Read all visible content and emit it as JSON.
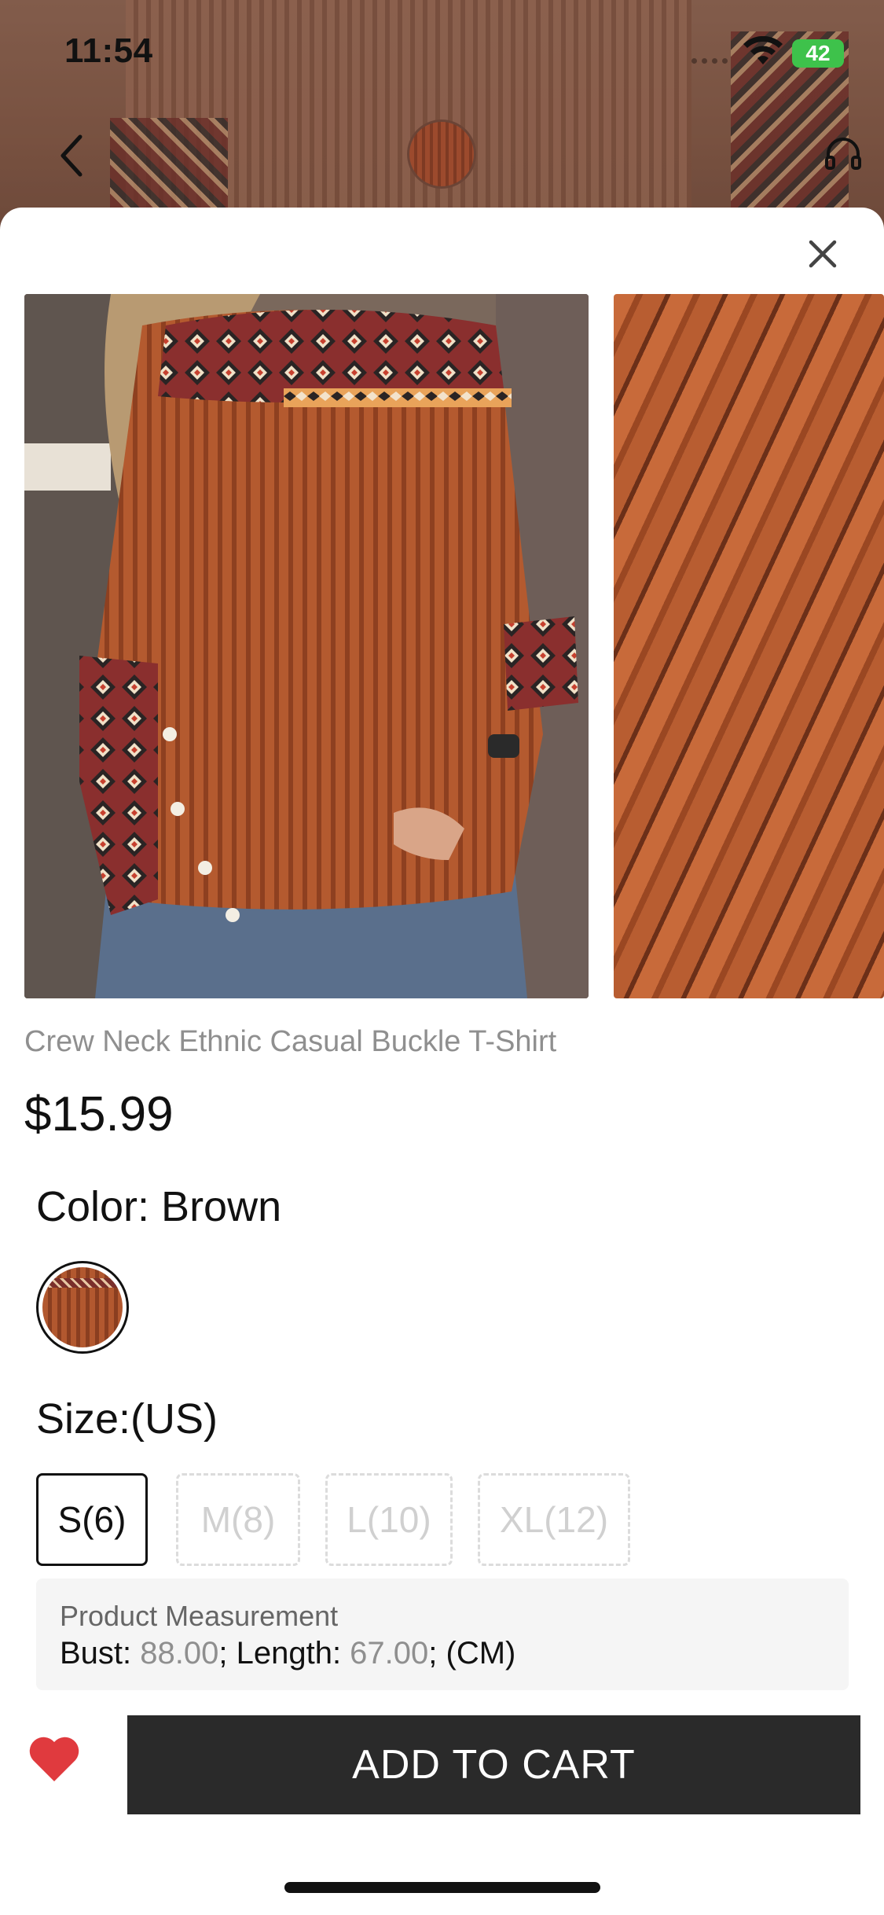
{
  "status_bar": {
    "time": "11:54",
    "battery": "42"
  },
  "product": {
    "title": "Crew Neck Ethnic Casual Buckle T-Shirt",
    "price": "$15.99"
  },
  "color": {
    "label": "Color: Brown",
    "selected": "Brown"
  },
  "size": {
    "label": "Size:(US)",
    "options": [
      {
        "label": "S(6)",
        "available": true,
        "selected": true
      },
      {
        "label": "M(8)",
        "available": false,
        "selected": false
      },
      {
        "label": "L(10)",
        "available": false,
        "selected": false
      },
      {
        "label": "XL(12)",
        "available": false,
        "selected": false
      }
    ]
  },
  "measurement": {
    "title": "Product Measurement",
    "bust_label": "Bust: ",
    "bust_value": "88.00",
    "length_label": "; Length: ",
    "length_value": "67.00",
    "unit": "; (CM)"
  },
  "actions": {
    "add_to_cart": "ADD TO CART"
  },
  "colors": {
    "button_dark": "#2a2a2a",
    "heart": "#e03a3e",
    "muted_text": "#8f8f8f",
    "battery": "#3ec24b"
  },
  "icons": [
    "back-icon",
    "product-thumbnail",
    "headset-icon",
    "close-icon",
    "heart-icon",
    "wifi-icon",
    "battery-icon"
  ]
}
